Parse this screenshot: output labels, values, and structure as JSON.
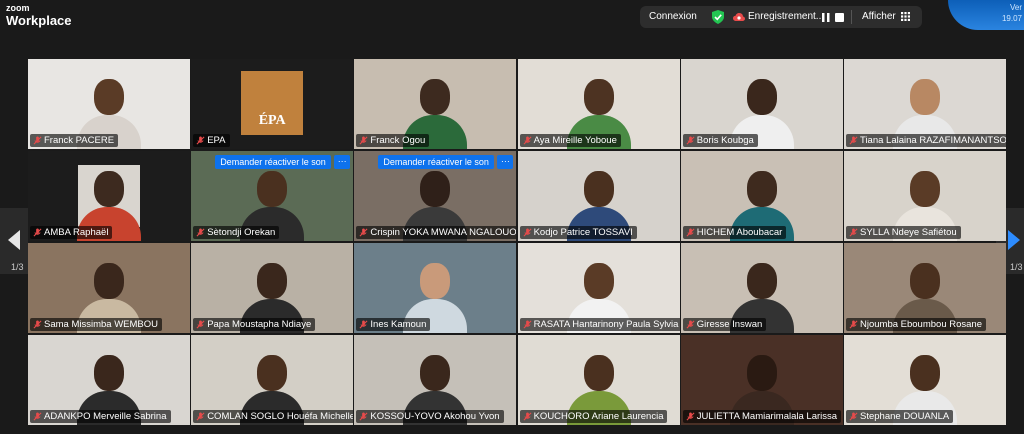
{
  "app": {
    "logo_line1": "zoom",
    "logo_line2": "Workplace"
  },
  "toolbar": {
    "connexion": "Connexion",
    "recording": "Enregistrement...",
    "afficher": "Afficher"
  },
  "corner": {
    "line1": "Ver",
    "line2": "19.07"
  },
  "pagination": {
    "left": "1/3",
    "right": "1/3"
  },
  "request_label": "Demander réactiver le son",
  "more_label": "···",
  "tiles": [
    {
      "name": "Franck PACERE",
      "bg": "#e8e6e3",
      "skin": "#5a3b26",
      "shirt": "#d8d2cc"
    },
    {
      "name": "EPA",
      "bg": "#1c1c1c",
      "logo": "ÉPA"
    },
    {
      "name": "Franck Ogou",
      "bg": "#c7bdb0",
      "skin": "#3d2a1f",
      "shirt": "#2b6a3a"
    },
    {
      "name": "Aya Mireille Yoboue",
      "bg": "#e2ddd6",
      "skin": "#4d3322",
      "shirt": "#4a8b45"
    },
    {
      "name": "Boris Koubga",
      "bg": "#d9d5cf",
      "skin": "#3a271c",
      "shirt": "#efefef"
    },
    {
      "name": "Tiana Lalaina RAZAFIMANANTSOA",
      "bg": "#dcd8d3",
      "skin": "#b88863",
      "shirt": "#e8e8e8"
    },
    {
      "name": "AMBA Raphaël",
      "bg": "#1c1c1c",
      "skin": "#3d2a1f",
      "shirt": "#c8432e"
    },
    {
      "name": "Sètondji Orekan",
      "bg": "#5b6b55",
      "skin": "#4a301f",
      "shirt": "#2b2b2b"
    },
    {
      "name": "Crispin YOKA MWANA NGALOUO",
      "bg": "#7a6e64",
      "skin": "#2f2019",
      "shirt": "#3a3a3a"
    },
    {
      "name": "Kodjo Patrice TOSSAVI",
      "bg": "#d6d2cc",
      "skin": "#4a301f",
      "shirt": "#2e4a7a"
    },
    {
      "name": "HICHEM Aboubacar",
      "bg": "#c9c0b5",
      "skin": "#3e2a1e",
      "shirt": "#1e6b75"
    },
    {
      "name": "SYLLA Ndeye Safiétou",
      "bg": "#d8d3cb",
      "skin": "#5a3b26",
      "shirt": "#e9e4dd"
    },
    {
      "name": "Sama Missimba WEMBOU",
      "bg": "#8a7460",
      "skin": "#3a271c",
      "shirt": "#c9b9a1"
    },
    {
      "name": "Papa Moustapha Ndiaye",
      "bg": "#b9b1a5",
      "skin": "#3a271c",
      "shirt": "#2b2b2b"
    },
    {
      "name": "Ines Kamoun",
      "bg": "#6c7f8a",
      "skin": "#c99a7a",
      "shirt": "#cfd9e0"
    },
    {
      "name": "RASATA Hantarinony Paula Sylvia",
      "bg": "#e4e0da",
      "skin": "#5a3b26",
      "shirt": "#f2f2f2"
    },
    {
      "name": "Giresse Inswan",
      "bg": "#c8bfb4",
      "skin": "#3a271c",
      "shirt": "#333333"
    },
    {
      "name": "Njoumba Eboumbou Rosane",
      "bg": "#9a8878",
      "skin": "#4a301f",
      "shirt": "#6a5a4a"
    },
    {
      "name": "ADANKPO Merveille Sabrina",
      "bg": "#d9d6d1",
      "skin": "#3a271c",
      "shirt": "#2b2b2b"
    },
    {
      "name": "COMLAN SOGLO Houéfa Michelle",
      "bg": "#d3cfc6",
      "skin": "#4a301f",
      "shirt": "#2b2b2b"
    },
    {
      "name": "KOSSOU-YOVO Akohou Yvon",
      "bg": "#c5c0b8",
      "skin": "#3a271c",
      "shirt": "#333333"
    },
    {
      "name": "KOUCHORO Ariane Laurencia",
      "bg": "#e0dcd4",
      "skin": "#4a301f",
      "shirt": "#7a9a3a"
    },
    {
      "name": "JULIETTA Mamiarimalala Larissa",
      "bg": "#4a3026",
      "skin": "#2a1a12",
      "shirt": "#3a2820"
    },
    {
      "name": "Stephane DOUANLA",
      "bg": "#e3ded6",
      "skin": "#4a301f",
      "shirt": "#e9e9e9"
    }
  ]
}
